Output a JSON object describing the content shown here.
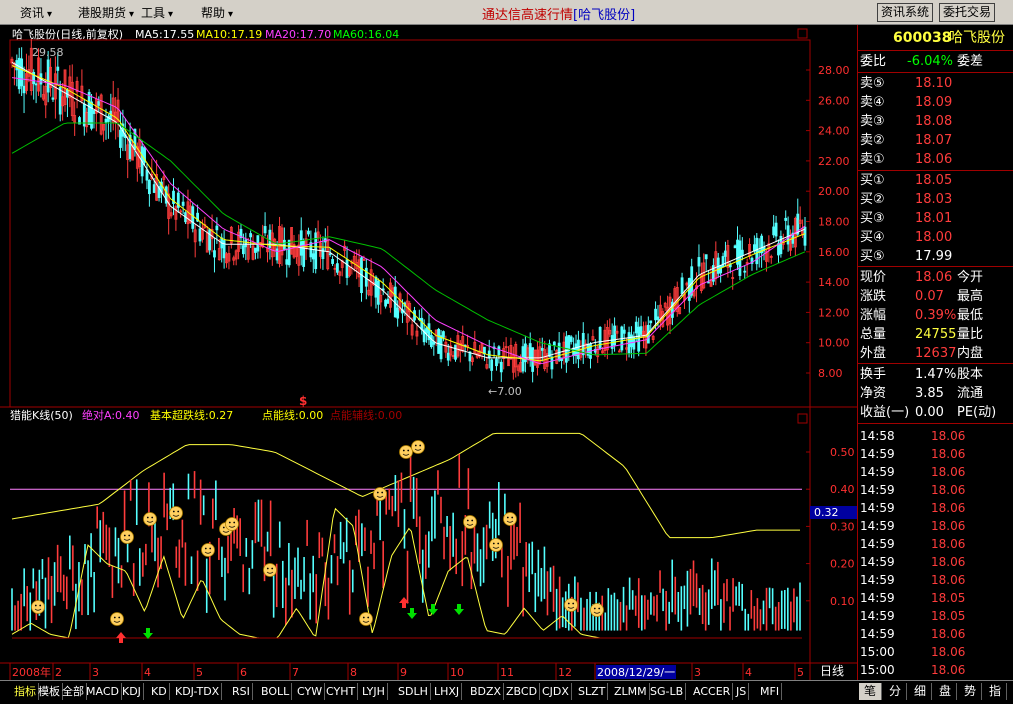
{
  "menubar": {
    "items": [
      "资讯",
      "港股期货",
      "工具",
      "帮助"
    ],
    "title": "通达信高速行情",
    "title_stock": "[哈飞股份]",
    "btn_news": "资讯系统",
    "btn_trade": "委托交易"
  },
  "chart_header": {
    "stock_label": "哈飞股份(日线,前复权)",
    "ma5": "MA5:17.55",
    "ma10": "MA10:17.19",
    "ma20": "MA20:17.70",
    "ma60": "MA60:16.04"
  },
  "price_annotations": {
    "high": "29.58",
    "low": "←7.00",
    "marker": "$"
  },
  "indicator_header": {
    "name": "猎能K线(50)",
    "abs": "绝对A:0.40",
    "base": "基本超跌线:0.27",
    "point": "点能线:0.00",
    "point_aux": "点能辅线:0.00"
  },
  "indicator_value_tag": "0.32",
  "price_axis": [
    "28.00",
    "26.00",
    "24.00",
    "22.00",
    "20.00",
    "18.00",
    "16.00",
    "14.00",
    "12.00",
    "10.00",
    "8.00"
  ],
  "ind_axis": [
    "0.50",
    "0.40",
    "0.30",
    "0.20",
    "0.10"
  ],
  "x_axis": {
    "labels": [
      "2008年",
      "2",
      "3",
      "4",
      "5",
      "6",
      "7",
      "8",
      "9",
      "10",
      "11",
      "12",
      "2008/12/29/一",
      "3",
      "4",
      "5"
    ],
    "period": "日线"
  },
  "colors": {
    "up": "#ff3c3c",
    "down": "#54ffff",
    "ma5": "#ffffff",
    "ma10": "#ffff00",
    "ma20": "#ff40ff",
    "ma60": "#00c000",
    "border": "#a00000"
  },
  "side": {
    "code": "600038",
    "name": "哈飞股份",
    "weibi_label": "委比",
    "weibi_value": "-6.04%",
    "weicha_label": "委差",
    "sells": [
      {
        "label": "卖⑤",
        "price": "18.10"
      },
      {
        "label": "卖④",
        "price": "18.09"
      },
      {
        "label": "卖③",
        "price": "18.08"
      },
      {
        "label": "卖②",
        "price": "18.07"
      },
      {
        "label": "卖①",
        "price": "18.06"
      }
    ],
    "buys": [
      {
        "label": "买①",
        "price": "18.05"
      },
      {
        "label": "买②",
        "price": "18.03"
      },
      {
        "label": "买③",
        "price": "18.01"
      },
      {
        "label": "买④",
        "price": "18.00"
      },
      {
        "label": "买⑤",
        "price": "17.99"
      }
    ],
    "stats": [
      {
        "l1": "现价",
        "v1": "18.06",
        "l2": "今开"
      },
      {
        "l1": "涨跌",
        "v1": "0.07",
        "l2": "最高"
      },
      {
        "l1": "涨幅",
        "v1": "0.39%",
        "l2": "最低"
      },
      {
        "l1": "总量",
        "v1": "24755",
        "l2": "量比"
      },
      {
        "l1": "外盘",
        "v1": "12637",
        "l2": "内盘"
      }
    ],
    "stats2": [
      {
        "l1": "换手",
        "v1": "1.47%",
        "l2": "股本"
      },
      {
        "l1": "净资",
        "v1": "3.85",
        "l2": "流通"
      },
      {
        "l1": "收益(一)",
        "v1": "0.00",
        "l2": "PE(动)"
      }
    ],
    "ticks": [
      {
        "time": "14:58",
        "price": "18.06"
      },
      {
        "time": "14:59",
        "price": "18.06"
      },
      {
        "time": "14:59",
        "price": "18.06"
      },
      {
        "time": "14:59",
        "price": "18.06"
      },
      {
        "time": "14:59",
        "price": "18.06"
      },
      {
        "time": "14:59",
        "price": "18.06"
      },
      {
        "time": "14:59",
        "price": "18.06"
      },
      {
        "time": "14:59",
        "price": "18.06"
      },
      {
        "time": "14:59",
        "price": "18.06"
      },
      {
        "time": "14:59",
        "price": "18.05"
      },
      {
        "time": "14:59",
        "price": "18.05"
      },
      {
        "time": "14:59",
        "price": "18.06"
      },
      {
        "time": "15:00",
        "price": "18.06"
      },
      {
        "time": "15:00",
        "price": "18.06"
      }
    ],
    "tabs": [
      "笔",
      "分",
      "细",
      "盘",
      "势",
      "指"
    ]
  },
  "tabs": [
    "指标",
    "模板",
    "全部",
    "MACD",
    "KDJ",
    "KD",
    "KDJ-TDX",
    "RSI",
    "BOLL",
    "CYW",
    "CYHT",
    "LYJH",
    "SDLH",
    "LHXJ",
    "BDZX",
    "ZBCD",
    "CJDX",
    "SLZT",
    "ZLMM",
    "SG-LB",
    "ACCER",
    "JS",
    "MFI"
  ],
  "chart_data": {
    "type": "line",
    "title": "哈飞股份(日线,前复权)",
    "x": [
      "2008-01",
      "2008-02",
      "2008-03",
      "2008-04",
      "2008-05",
      "2008-06",
      "2008-07",
      "2008-08",
      "2008-09",
      "2008-10",
      "2008-11",
      "2008-12",
      "2009-01",
      "2009-03",
      "2009-04",
      "2009-05"
    ],
    "series": [
      {
        "name": "MA5",
        "values": [
          28.5,
          26.5,
          24.5,
          19.0,
          16.5,
          16.5,
          16.0,
          13.5,
          10.0,
          9.0,
          9.0,
          10.0,
          10.5,
          14.5,
          16.0,
          17.5
        ]
      },
      {
        "name": "MA10",
        "values": [
          28.3,
          26.8,
          24.8,
          19.5,
          16.8,
          16.4,
          16.3,
          14.0,
          10.5,
          9.2,
          8.8,
          9.8,
          10.4,
          14.3,
          15.8,
          17.2
        ]
      },
      {
        "name": "MA20",
        "values": [
          27.5,
          27.0,
          25.5,
          20.5,
          17.5,
          16.0,
          16.8,
          15.0,
          11.5,
          9.8,
          8.6,
          9.5,
          10.2,
          13.8,
          15.3,
          17.7
        ]
      },
      {
        "name": "MA60",
        "values": [
          22.5,
          24.5,
          24.5,
          22.0,
          18.5,
          16.5,
          17.0,
          16.2,
          13.5,
          11.5,
          10.0,
          9.2,
          9.3,
          12.5,
          14.5,
          16.0
        ]
      }
    ],
    "ylim": [
      7.0,
      29.58
    ],
    "indicator": {
      "name": "猎能K线(50)",
      "ylim": [
        0.0,
        0.55
      ],
      "abs_line": 0.4,
      "base_line": 0.27
    }
  }
}
